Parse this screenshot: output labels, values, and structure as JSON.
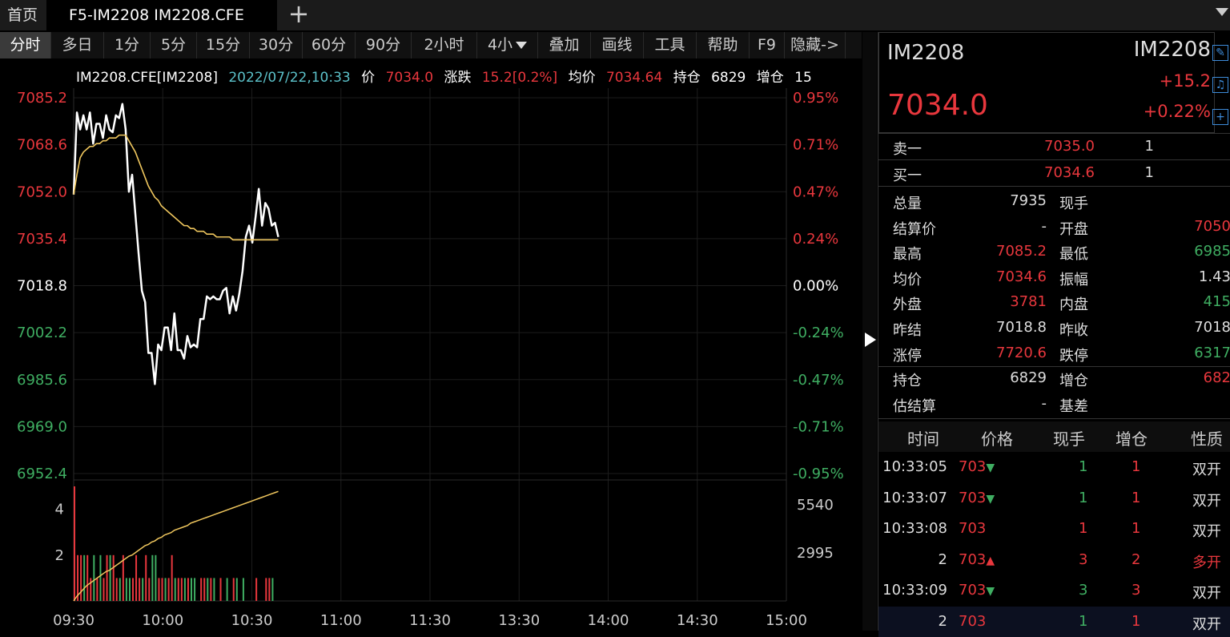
{
  "tabs": {
    "home": "首页",
    "active": "F5-IM2208 IM2208.CFE",
    "add": "+"
  },
  "toolbar": [
    "分时",
    "多日",
    "1分",
    "5分",
    "15分",
    "30分",
    "60分",
    "90分",
    "2小时",
    "4小",
    "叠加",
    "画线",
    "工具",
    "帮助",
    "F9",
    "隐藏->"
  ],
  "header": {
    "code": "IM2208.CFE[IM2208]",
    "datetime": "2022/07/22,10:33",
    "price_label": "价",
    "price": "7034.0",
    "chg_label": "涨跌",
    "chg": "15.2[0.2%]",
    "avg_label": "均价",
    "avg": "7034.64",
    "oi_label": "持仓",
    "oi": "6829",
    "inc_label": "增仓",
    "inc": "15"
  },
  "chart_data": {
    "type": "line",
    "y_left_labels": [
      "7085.2",
      "7068.6",
      "7052.0",
      "7035.4",
      "7018.8",
      "7002.2",
      "6985.6",
      "6969.0",
      "6952.4"
    ],
    "y_right_labels": [
      "0.95%",
      "0.71%",
      "0.47%",
      "0.24%",
      "0.00%",
      "-0.24%",
      "-0.47%",
      "-0.71%",
      "-0.95%"
    ],
    "x_labels": [
      "09:30",
      "10:00",
      "10:30",
      "11:00",
      "11:30",
      "13:30",
      "14:00",
      "14:30",
      "15:00"
    ],
    "ylim": [
      6952.4,
      7085.2
    ],
    "prev_settle": 7018.8,
    "series": [
      {
        "values": [
          7051,
          7080,
          7074,
          7079,
          7074,
          7080,
          7069,
          7076,
          7076,
          7071,
          7079,
          7074,
          7073,
          7079,
          7078,
          7083,
          7074,
          7052,
          7058,
          7044,
          7030,
          7017,
          7013,
          6995,
          6995,
          6984,
          6998,
          6996,
          7004,
          7004,
          6996,
          7009,
          6996,
          6996,
          6993,
          7001,
          6997,
          6998,
          6997,
          7007,
          7007,
          7015,
          7014,
          7015,
          7014,
          7014,
          7017,
          7018,
          7009,
          7015,
          7010,
          7016,
          7024,
          7036,
          7040,
          7034,
          7043,
          7053,
          7040,
          7048,
          7046,
          7040,
          7041,
          7036
        ]
      },
      {
        "values": [
          7051,
          7058,
          7064,
          7066,
          7067,
          7068,
          7068,
          7069,
          7069,
          7070,
          7070,
          7071,
          7071,
          7071,
          7072,
          7072,
          7072,
          7070,
          7068,
          7066,
          7063,
          7060,
          7057,
          7054,
          7052,
          7050,
          7049,
          7047,
          7046,
          7045,
          7044,
          7043,
          7042,
          7041,
          7040,
          7040,
          7039,
          7039,
          7038,
          7038,
          7038,
          7037,
          7037,
          7037,
          7036,
          7036,
          7036,
          7036,
          7036,
          7035,
          7035,
          7035,
          7035,
          7035,
          7035,
          7035,
          7035,
          7035,
          7035,
          7035,
          7035,
          7035,
          7035,
          7035
        ]
      }
    ],
    "volume": {
      "left_labels": [
        "4",
        "2"
      ],
      "right_labels": [
        "5540",
        "2995"
      ],
      "bars": [
        5,
        2,
        2,
        2,
        2,
        1,
        2,
        1,
        2,
        1,
        2,
        2,
        2,
        1,
        1,
        2,
        1,
        1,
        1,
        2,
        1,
        1,
        2,
        1,
        2,
        2,
        1,
        1,
        1,
        1,
        2,
        1,
        1,
        1,
        1,
        1,
        1,
        1,
        0,
        1,
        1,
        1,
        1,
        1,
        0,
        1,
        0,
        1,
        0,
        1,
        1,
        0,
        1,
        0,
        0,
        0,
        1,
        0,
        0,
        1,
        1,
        1,
        0,
        0
      ],
      "bar_colors": [
        "r",
        "r",
        "r",
        "g",
        "r",
        "r",
        "g",
        "r",
        "g",
        "r",
        "r",
        "g",
        "r",
        "r",
        "g",
        "r",
        "g",
        "g",
        "r",
        "r",
        "r",
        "g",
        "r",
        "r",
        "g",
        "g",
        "r",
        "r",
        "g",
        "r",
        "r",
        "g",
        "r",
        "r",
        "g",
        "r",
        "g",
        "g",
        "r",
        "r",
        "r",
        "g",
        "r",
        "g",
        "r",
        "r",
        "r",
        "g",
        "r",
        "r",
        "g",
        "r",
        "g",
        "r",
        "r",
        "g",
        "r",
        "r",
        "g",
        "r",
        "r",
        "g",
        "r",
        "r"
      ],
      "oi_values": [
        0,
        0.04,
        0.07,
        0.1,
        0.13,
        0.15,
        0.17,
        0.19,
        0.21,
        0.23,
        0.25,
        0.26,
        0.28,
        0.3,
        0.32,
        0.34,
        0.36,
        0.38,
        0.39,
        0.41,
        0.43,
        0.45,
        0.47,
        0.48,
        0.5,
        0.51,
        0.53,
        0.54,
        0.56,
        0.57,
        0.58,
        0.6,
        0.61,
        0.62,
        0.63,
        0.64,
        0.66,
        0.67,
        0.68,
        0.69,
        0.7,
        0.71,
        0.72,
        0.73,
        0.74,
        0.75,
        0.76,
        0.77,
        0.78,
        0.79,
        0.8,
        0.81,
        0.82,
        0.83,
        0.84,
        0.85,
        0.86,
        0.87,
        0.88,
        0.89,
        0.9,
        0.91,
        0.92,
        0.93
      ]
    }
  },
  "quote": {
    "code_left": "IM2208",
    "code_right": "IM2208",
    "price": "7034.0",
    "chg": "+15.2",
    "pct": "+0.22%"
  },
  "book": [
    {
      "k": "卖一",
      "v": "7035.0",
      "q": "1"
    },
    {
      "k": "买一",
      "v": "7034.6",
      "q": "1"
    }
  ],
  "stats": [
    {
      "k1": "总量",
      "v1": "7935",
      "c1": "w",
      "k2": "现手",
      "v2": "",
      "c2": "w"
    },
    {
      "k1": "结算价",
      "v1": "-",
      "c1": "w",
      "k2": "开盘",
      "v2": "7050",
      "c2": "r"
    },
    {
      "k1": "最高",
      "v1": "7085.2",
      "c1": "r",
      "k2": "最低",
      "v2": "6985",
      "c2": "g"
    },
    {
      "k1": "均价",
      "v1": "7034.6",
      "c1": "r",
      "k2": "振幅",
      "v2": "1.43",
      "c2": "w"
    },
    {
      "k1": "外盘",
      "v1": "3781",
      "c1": "r",
      "k2": "内盘",
      "v2": "415",
      "c2": "g"
    },
    {
      "k1": "昨结",
      "v1": "7018.8",
      "c1": "w",
      "k2": "昨收",
      "v2": "7018",
      "c2": "w"
    },
    {
      "k1": "涨停",
      "v1": "7720.6",
      "c1": "r",
      "k2": "跌停",
      "v2": "6317",
      "c2": "g"
    },
    {
      "k1": "持仓",
      "v1": "6829",
      "c1": "w",
      "k2": "增仓",
      "v2": "682",
      "c2": "r"
    },
    {
      "k1": "估结算",
      "v1": "-",
      "c1": "w",
      "k2": "基差",
      "v2": "",
      "c2": "w"
    }
  ],
  "trades_header": [
    "时间",
    "价格",
    "现手",
    "增仓",
    "性质"
  ],
  "trades": [
    {
      "t": "10:33:05",
      "p": "703",
      "dir": "down",
      "vol": "1",
      "vc": "g",
      "oi": "1",
      "nature": "双开",
      "nc": "w"
    },
    {
      "t": "10:33:07",
      "p": "703",
      "dir": "down",
      "vol": "1",
      "vc": "g",
      "oi": "1",
      "nature": "双开",
      "nc": "w"
    },
    {
      "t": "10:33:08",
      "p": "703",
      "dir": "",
      "vol": "1",
      "vc": "r",
      "oi": "1",
      "nature": "双开",
      "nc": "w"
    },
    {
      "t": "2",
      "p": "703",
      "dir": "up",
      "vol": "3",
      "vc": "r",
      "oi": "2",
      "nature": "多开",
      "nc": "r"
    },
    {
      "t": "10:33:09",
      "p": "703",
      "dir": "down",
      "vol": "3",
      "vc": "g",
      "oi": "3",
      "nature": "双开",
      "nc": "w"
    },
    {
      "t": "2",
      "p": "703",
      "dir": "",
      "vol": "1",
      "vc": "g",
      "oi": "1",
      "nature": "双开",
      "nc": "w"
    }
  ]
}
